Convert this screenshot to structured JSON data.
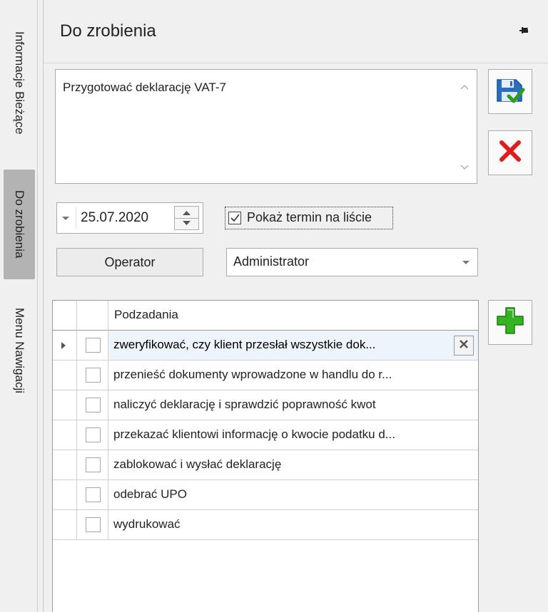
{
  "sidebar": {
    "tabs": [
      {
        "label": "Informacje Bieżące",
        "active": false
      },
      {
        "label": "Do zrobienia",
        "active": true
      },
      {
        "label": "Menu Nawigacji",
        "active": false
      }
    ]
  },
  "panel": {
    "title": "Do zrobienia",
    "pin_icon": "pin-icon"
  },
  "task": {
    "description": "Przygotować deklarację VAT-7",
    "save_icon": "save-disk-check-icon",
    "cancel_icon": "red-x-icon"
  },
  "deadline": {
    "date": "25.07.2020",
    "show_on_list_label": "Pokaż termin na liście",
    "show_on_list_checked": true
  },
  "operator": {
    "button_label": "Operator",
    "selected_value": "Administrator"
  },
  "subtasks": {
    "header": "Podzadania",
    "add_icon": "green-plus-icon",
    "rows": [
      {
        "text": "zweryfikować, czy klient przesłał wszystkie dok...",
        "checked": false,
        "selected": true
      },
      {
        "text": "przenieść dokumenty wprowadzone w handlu do r...",
        "checked": false,
        "selected": false
      },
      {
        "text": "naliczyć deklarację i sprawdzić poprawność kwot",
        "checked": false,
        "selected": false
      },
      {
        "text": "przekazać klientowi informację o kwocie podatku d...",
        "checked": false,
        "selected": false
      },
      {
        "text": "zablokować i wysłać deklarację",
        "checked": false,
        "selected": false
      },
      {
        "text": "odebrać UPO",
        "checked": false,
        "selected": false
      },
      {
        "text": "wydrukować",
        "checked": false,
        "selected": false
      }
    ]
  }
}
